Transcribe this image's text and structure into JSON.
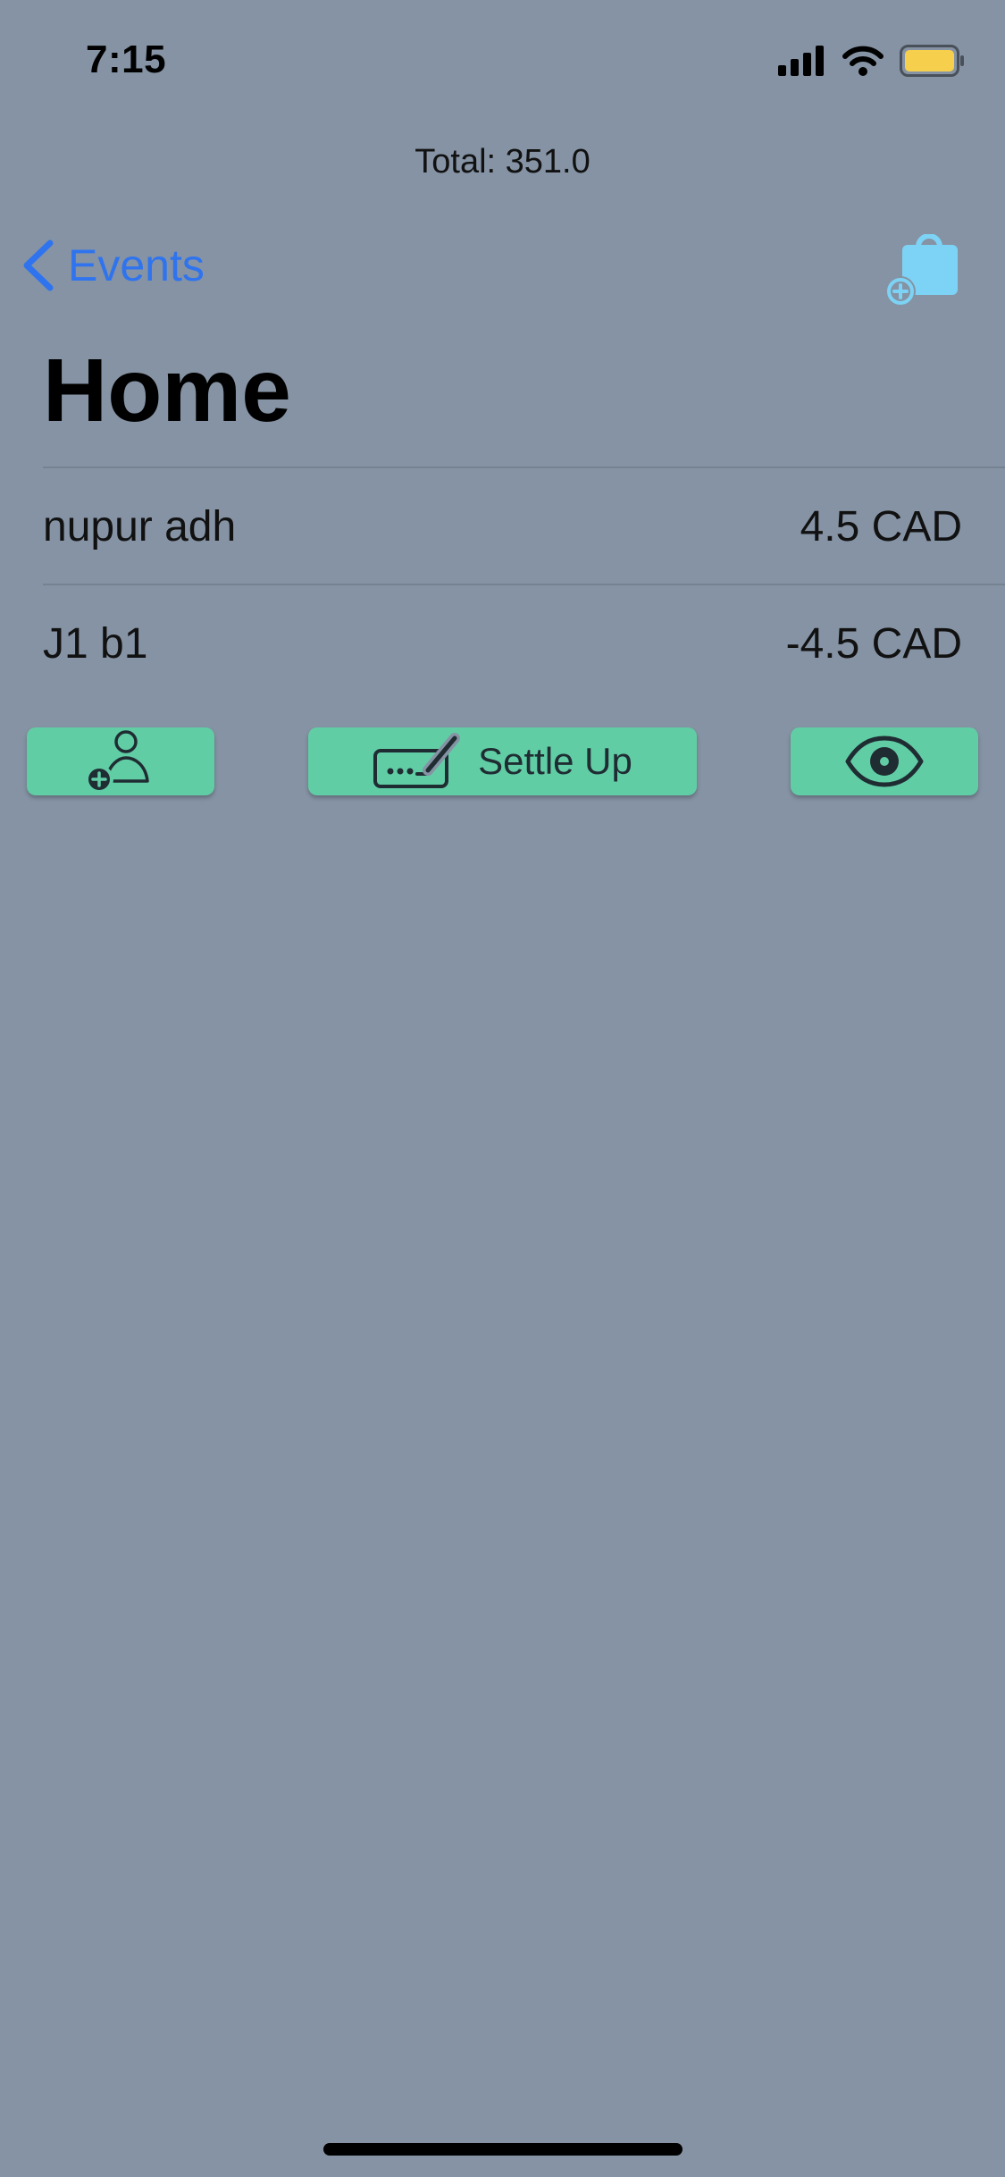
{
  "status_bar": {
    "time": "7:15",
    "icons": [
      "signal-icon",
      "wifi-icon",
      "battery-icon"
    ],
    "battery_color": "#f6d04d"
  },
  "header": {
    "total_text": "Total: 351.0"
  },
  "nav": {
    "back_label": "Events",
    "back_icon": "chevron-left-icon",
    "add_event_icon": "bag-plus-icon",
    "accent_color": "#2f74ee",
    "add_icon_color": "#7dd3f5"
  },
  "page": {
    "title": "Home"
  },
  "members": [
    {
      "name": "nupur adh",
      "amount": "4.5 CAD"
    },
    {
      "name": "J1 b1",
      "amount": "-4.5 CAD"
    }
  ],
  "actions": {
    "add_member_icon": "person-plus-icon",
    "settle_icon": "signature-icon",
    "settle_label": "Settle Up",
    "view_icon": "eye-icon",
    "button_color": "#61cda5"
  },
  "background_color": "#8593a4"
}
